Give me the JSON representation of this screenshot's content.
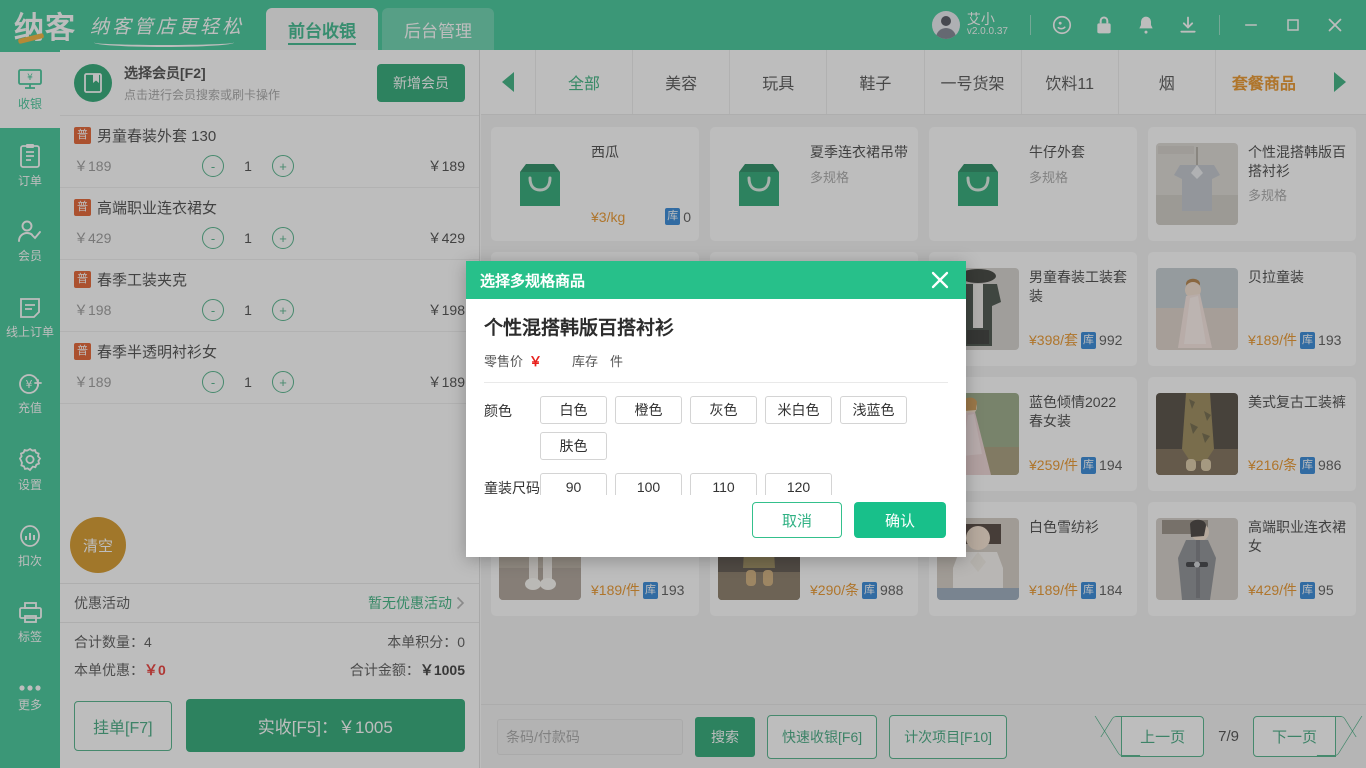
{
  "header": {
    "brand": "纳客",
    "slogan": "纳客管店更轻松",
    "tabs": [
      {
        "label": "前台收银",
        "active": true
      },
      {
        "label": "后台管理",
        "active": false
      }
    ],
    "user": {
      "name": "艾小",
      "version": "v2.0.0.37",
      "avatar_icon": "avatar"
    },
    "icons": [
      "headset-icon",
      "lock-icon",
      "bell-icon",
      "download-icon"
    ],
    "window_controls": [
      "minimize-icon",
      "maximize-icon",
      "close-icon"
    ],
    "accent": "#27c08a"
  },
  "sidebar": {
    "items": [
      {
        "label": "收银",
        "icon": "cashier-icon",
        "active": true
      },
      {
        "label": "订单",
        "icon": "order-icon",
        "active": false
      },
      {
        "label": "会员",
        "icon": "member-icon",
        "active": false
      },
      {
        "label": "线上订单",
        "icon": "online-order-icon",
        "active": false
      },
      {
        "label": "充值",
        "icon": "recharge-icon",
        "active": false
      },
      {
        "label": "设置",
        "icon": "gear-icon",
        "active": false
      },
      {
        "label": "扣次",
        "icon": "deduct-icon",
        "active": false
      },
      {
        "label": "标签",
        "icon": "printer-icon",
        "active": false
      },
      {
        "label": "更多",
        "icon": "more-icon",
        "active": false
      }
    ]
  },
  "cart": {
    "member": {
      "title": "选择会员[F2]",
      "subtitle": "点击进行会员搜索或刷卡操作",
      "add_label": "新增会员",
      "icon": "member-card-icon"
    },
    "item_tag": "普",
    "items": [
      {
        "name": "男童春装外套 130",
        "price": "￥189",
        "qty": "1",
        "total": "￥189"
      },
      {
        "name": "高端职业连衣裙女",
        "price": "￥429",
        "qty": "1",
        "total": "￥429"
      },
      {
        "name": "春季工装夹克",
        "price": "￥198",
        "qty": "1",
        "total": "￥198"
      },
      {
        "name": "春季半透明衬衫女",
        "price": "￥189",
        "qty": "1",
        "total": "￥189"
      }
    ],
    "clear_label": "清空",
    "promo": {
      "label": "优惠活动",
      "value": "暂无优惠活动"
    },
    "totals": {
      "qty_label": "合计数量：",
      "qty_value": "4",
      "points_label": "本单积分：",
      "points_value": "0",
      "discount_label": "本单优惠：",
      "discount_value": "￥0",
      "amount_label": "合计金额：",
      "amount_value": "￥1005"
    },
    "hang_label": "挂单[F7]",
    "pay_label": "实收[F5]：￥1005"
  },
  "categories": {
    "prev_icon": "left-arrow-icon",
    "next_icon": "right-arrow-icon",
    "items": [
      {
        "label": "全部",
        "state": "selected"
      },
      {
        "label": "美容",
        "state": "normal"
      },
      {
        "label": "玩具",
        "state": "normal"
      },
      {
        "label": "鞋子",
        "state": "normal"
      },
      {
        "label": "一号货架",
        "state": "normal"
      },
      {
        "label": "饮料11",
        "state": "normal"
      },
      {
        "label": "烟",
        "state": "normal"
      },
      {
        "label": "套餐商品",
        "state": "highlight"
      }
    ]
  },
  "products": [
    {
      "name": "西瓜",
      "sub": "",
      "price": "¥3/kg",
      "stock_tag": "库",
      "stock": "0",
      "thumb": "bag"
    },
    {
      "name": "夏季连衣裙吊带",
      "sub": "多规格",
      "price": "",
      "stock_tag": "",
      "stock": "",
      "thumb": "bag"
    },
    {
      "name": "牛仔外套",
      "sub": "多规格",
      "price": "",
      "stock_tag": "",
      "stock": "",
      "thumb": "bag"
    },
    {
      "name": "个性混搭韩版百搭衬衫",
      "sub": "多规格",
      "price": "",
      "stock_tag": "",
      "stock": "",
      "thumb": "shirt"
    },
    {
      "name": "",
      "sub": "",
      "price": "",
      "stock_tag": "",
      "stock": "",
      "thumb": "hidden"
    },
    {
      "name": "",
      "sub": "",
      "price": "",
      "stock_tag": "",
      "stock": "",
      "thumb": "hidden"
    },
    {
      "name": "男童春装工装套装",
      "sub": "",
      "price": "¥398/套",
      "stock_tag": "库",
      "stock": "992",
      "thumb": "boyset"
    },
    {
      "name": "贝拉童装",
      "sub": "",
      "price": "¥189/件",
      "stock_tag": "库",
      "stock": "193",
      "thumb": "girldress"
    },
    {
      "name": "",
      "sub": "",
      "price": "",
      "stock_tag": "",
      "stock": "",
      "thumb": "hidden"
    },
    {
      "name": "",
      "sub": "",
      "price": "",
      "stock_tag": "",
      "stock": "",
      "thumb": "hidden"
    },
    {
      "name": "蓝色倾情2022春女装",
      "sub": "",
      "price": "¥259/件",
      "stock_tag": "库",
      "stock": "194",
      "thumb": "pinkdress"
    },
    {
      "name": "美式复古工装裤",
      "sub": "",
      "price": "¥216/条",
      "stock_tag": "库",
      "stock": "986",
      "thumb": "camopants"
    },
    {
      "name": "",
      "sub": "",
      "price": "¥189/件",
      "stock_tag": "库",
      "stock": "193",
      "thumb": "shoes"
    },
    {
      "name": "",
      "sub": "",
      "price": "¥290/条",
      "stock_tag": "库",
      "stock": "988",
      "thumb": "boots"
    },
    {
      "name": "白色雪纺衫",
      "sub": "",
      "price": "¥189/件",
      "stock_tag": "库",
      "stock": "184",
      "thumb": "whiteblouse"
    },
    {
      "name": "高端职业连衣裙女",
      "sub": "",
      "price": "¥429/件",
      "stock_tag": "库",
      "stock": "95",
      "thumb": "graydress"
    }
  ],
  "bottombar": {
    "search_placeholder": "条码/付款码",
    "search_value": "",
    "keyboard_icon": "keyboard-icon",
    "search_label": "搜索",
    "quick_label": "快速收银[F6]",
    "count_label": "计次项目[F10]",
    "prev_page_label": "上一页",
    "page_indicator": "7/9",
    "next_page_label": "下一页"
  },
  "modal": {
    "title": "选择多规格商品",
    "close_icon": "close-icon",
    "product_name": "个性混搭韩版百搭衬衫",
    "retail_label": "零售价",
    "retail_symbol": "￥",
    "retail_value": "",
    "stock_label": "库存",
    "stock_value": "",
    "stock_unit": "件",
    "specs": [
      {
        "label": "颜色",
        "options": [
          "白色",
          "橙色",
          "灰色",
          "米白色",
          "浅蓝色",
          "肤色"
        ]
      },
      {
        "label": "童装尺码",
        "options": [
          "90",
          "100",
          "110",
          "120"
        ]
      }
    ],
    "cancel_label": "取消",
    "confirm_label": "确认"
  }
}
